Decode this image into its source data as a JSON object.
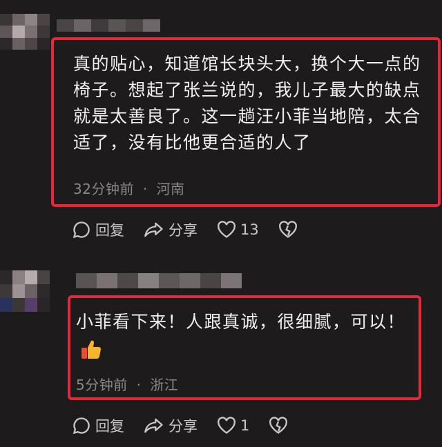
{
  "comments": [
    {
      "text": "真的贴心，知道馆长块头大，换个大一点的椅子。想起了张兰说的，我儿子最大的缺点就是太善良了。这一趟汪小菲当地陪，太合适了，没有比他更合适的人了",
      "time": "32分钟前",
      "location": "河南",
      "reply_label": "回复",
      "share_label": "分享",
      "like_count": "13",
      "emoji": ""
    },
    {
      "text": "小菲看下来！人跟真诚，很细腻，可以！",
      "time": "5分钟前",
      "location": "浙江",
      "reply_label": "回复",
      "share_label": "分享",
      "like_count": "1",
      "emoji": "thumbs-up"
    }
  ],
  "meta_separator": "·",
  "colors": {
    "background": "#1e1b1c",
    "highlight_border": "#e6283a",
    "meta_text": "#8b8889",
    "action_text": "#c9c7c8"
  },
  "icons": [
    "comment-bubble-icon",
    "share-arrow-icon",
    "heart-icon",
    "broken-heart-icon",
    "thumbs-up-icon"
  ]
}
